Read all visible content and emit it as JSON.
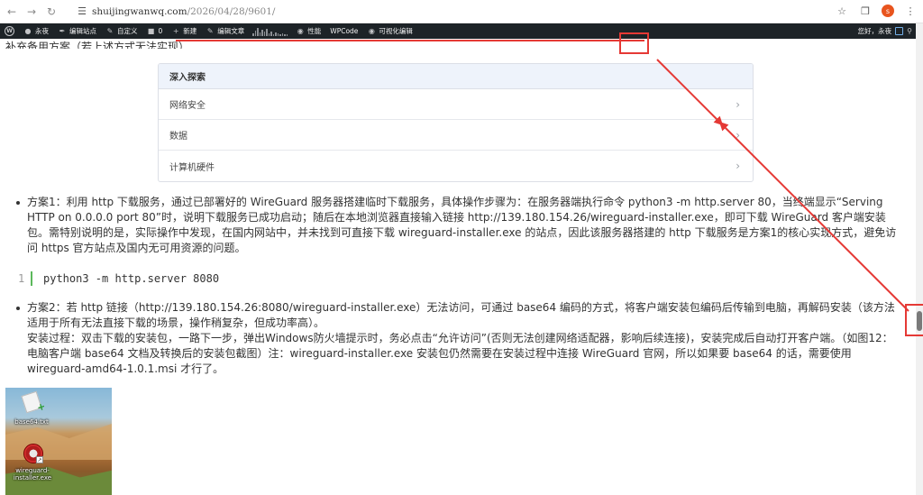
{
  "browser": {
    "url_host": "shuijingwanwq.com",
    "url_path": "/2026/04/28/9601/",
    "avatar_letter": "s"
  },
  "adminbar": {
    "items": [
      "永夜",
      "编辑站点",
      "自定义",
      "0",
      "新建",
      "编辑文章",
      "性能",
      "WPCode",
      "可视化编辑"
    ],
    "greeting": "您好，永夜"
  },
  "page": {
    "cut_heading": "补充备用方案（若上述方式无法实现）",
    "explore": {
      "title": "深入探索",
      "rows": [
        "网络安全",
        "数据",
        "计算机硬件"
      ]
    },
    "bullet1": "方案1：利用 http 下载服务，通过已部署好的 WireGuard 服务器搭建临时下载服务，具体操作步骤为：在服务器端执行命令 python3 -m http.server 80，当终端显示“Serving HTTP on 0.0.0.0 port 80”时，说明下载服务已成功启动；随后在本地浏览器直接输入链接 http://139.180.154.26/wireguard-installer.exe，即可下载 WireGuard 客户端安装包。需特别说明的是，实际操作中发现，在国内网站中，并未找到可直接下载 wireguard-installer.exe 的站点，因此该服务器搭建的 http 下载服务是方案1的核心实现方式，避免访问 https 官方站点及国内无可用资源的问题。",
    "code_line_no": "1",
    "code": "python3 -m http.server 8080",
    "bullet2_a": "方案2：若 http 链接（http://139.180.154.26:8080/wireguard-installer.exe）无法访问，可通过 base64 编码的方式，将客户端安装包编码后传输到电脑，再解码安装（该方法适用于所有无法直接下载的场景，操作稍复杂，但成功率高）。",
    "bullet2_b": "安装过程：双击下载的安装包，一路下一步，弹出Windows防火墙提示时，务必点击“允许访问”(否则无法创建网络适配器，影响后续连接)，安装完成后自动打开客户端。（如图12：电脑客户端 base64 文档及转换后的安装包截图）注：wireguard-installer.exe 安装包仍然需要在安装过程中连接 WireGuard 官网，所以如果要 base64 的话，需要使用 wireguard-amd64-1.0.1.msi 才行了。",
    "desktop": {
      "file1": "base64.txt",
      "file2_line1": "wireguard-",
      "file2_line2": "installer.exe"
    }
  },
  "colors": {
    "annotation": "#e53935",
    "adminbar_bg": "#1d2327"
  }
}
